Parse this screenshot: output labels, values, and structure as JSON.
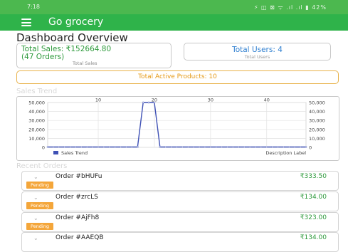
{
  "status_bar": {
    "time": "7:18",
    "icons_text": "⚡ ◫ ⊠ ᯤ .ıl .ıl ▮ 42%"
  },
  "app_bar": {
    "title": "Go grocery",
    "menu_icon": "menu-icon"
  },
  "page": {
    "title": "Dashboard Overview"
  },
  "stats": {
    "total_sales_value": "Total Sales: ₹152664.80 (47 Orders)",
    "total_sales_caption": "Total Sales",
    "total_users_value": "Total Users: 4",
    "total_users_caption": "Total Users",
    "active_products": "Total Active Products: 10"
  },
  "sales_trend": {
    "section_title": "Sales Trend",
    "legend_label": "Sales Trend",
    "description_label": "Description Label"
  },
  "chart_data": {
    "type": "line",
    "x_ticks": [
      "10",
      "20",
      "30",
      "40"
    ],
    "y_ticks": [
      "0",
      "10,000",
      "20,000",
      "30,000",
      "40,000",
      "50,000"
    ],
    "ylim": [
      0,
      50000
    ],
    "xlim": [
      1,
      47
    ],
    "grid": true,
    "legend_position": "bottom-left",
    "series": [
      {
        "name": "Sales Trend",
        "color": "#3f51b5",
        "x": [
          1,
          2,
          3,
          4,
          5,
          6,
          7,
          8,
          9,
          10,
          11,
          12,
          13,
          14,
          15,
          16,
          17,
          18,
          19,
          20,
          21,
          22,
          23,
          24,
          25,
          26,
          27,
          28,
          29,
          30,
          31,
          32,
          33,
          34,
          35,
          36,
          37,
          38,
          39,
          40,
          41,
          42,
          43,
          44,
          45,
          46,
          47
        ],
        "values": [
          400,
          400,
          400,
          400,
          400,
          400,
          400,
          400,
          400,
          400,
          400,
          400,
          400,
          400,
          400,
          400,
          400,
          50000,
          50000,
          50000,
          400,
          400,
          400,
          400,
          400,
          400,
          400,
          400,
          400,
          400,
          400,
          400,
          400,
          400,
          400,
          400,
          400,
          400,
          400,
          400,
          400,
          400,
          400,
          400,
          400,
          400,
          400
        ]
      }
    ]
  },
  "recent_orders": {
    "section_title": "Recent Orders",
    "orders": [
      {
        "id": "Order #bHUFu",
        "amount": "₹333.50",
        "status": "Pending"
      },
      {
        "id": "Order #zrcLS",
        "amount": "₹134.00",
        "status": "Pending"
      },
      {
        "id": "Order #AjFh8",
        "amount": "₹323.00",
        "status": "Pending"
      },
      {
        "id": "Order #AAEQB",
        "amount": "₹134.00",
        "status": ""
      }
    ]
  }
}
